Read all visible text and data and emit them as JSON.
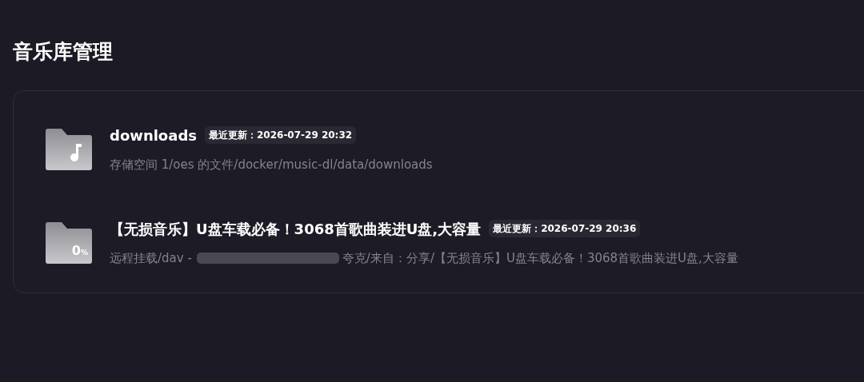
{
  "page_title": "音乐库管理",
  "libraries": [
    {
      "kind": "music",
      "name": "downloads",
      "updated_label": "最近更新：",
      "updated": "2026-07-29 20:32",
      "path": "存储空间 1/oes 的文件/docker/music-dl/data/downloads",
      "redacted": false
    },
    {
      "kind": "progress",
      "progress_value": "0",
      "progress_unit": "%",
      "name": "【无损音乐】U盘车载必备！3068首歌曲装进U盘,大容量",
      "updated_label": "最近更新：",
      "updated": "2026-07-29 20:36",
      "path": "远程挂载/dav -",
      "redacted": true,
      "path_rest": "夸克/来自：分享/【无损音乐】U盘车载必备！3068首歌曲装进U盘,大容量"
    }
  ]
}
